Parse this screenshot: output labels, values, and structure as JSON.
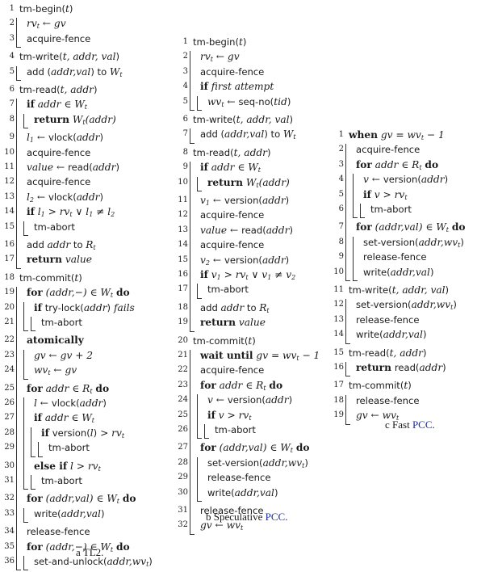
{
  "figures": [
    {
      "id": "a",
      "caption_label": "a",
      "caption_text": "TL2.",
      "caption_link": "",
      "lines": [
        {
          "n": "1",
          "d": 0,
          "html": "<span class='fn'>tm-begin(</span><span class='var'>t</span><span class='fn'>)</span>"
        },
        {
          "n": "2",
          "d": 1,
          "html": "<span class='var'>rv<sub>t</sub> ← gv</span>"
        },
        {
          "n": "3",
          "d": 1,
          "end": true,
          "html": "<span class='fn'>acquire-fence</span>",
          "gap": true
        },
        {
          "n": "4",
          "d": 0,
          "html": "<span class='fn'>tm-write(</span><span class='var'>t, addr, val</span><span class='fn'>)</span>"
        },
        {
          "n": "5",
          "d": 1,
          "end": true,
          "html": "<span class='fn'>add (</span><span class='var'>addr,val</span><span class='fn'>) to </span><span class='var'>W<sub>t</sub></span>",
          "gap": true
        },
        {
          "n": "6",
          "d": 0,
          "html": "<span class='fn'>tm-read(</span><span class='var'>t, addr</span><span class='fn'>)</span>"
        },
        {
          "n": "7",
          "d": 1,
          "html": "<span class='kw'>if</span> <span class='var'>addr ∈ W<sub>t</sub></span>"
        },
        {
          "n": "8",
          "d": 2,
          "end": true,
          "html": "<span class='kw'>return</span> <span class='var'>W<sub>t</sub>(addr)</span>",
          "gap": true
        },
        {
          "n": "9",
          "d": 1,
          "html": "<span class='var'>l<sub>1</sub></span> ← <span class='fn'>vlock(</span><span class='var'>addr</span><span class='fn'>)</span>"
        },
        {
          "n": "10",
          "d": 1,
          "html": "<span class='fn'>acquire-fence</span>"
        },
        {
          "n": "11",
          "d": 1,
          "html": "<span class='var'>value</span> ← <span class='fn'>read(</span><span class='var'>addr</span><span class='fn'>)</span>"
        },
        {
          "n": "12",
          "d": 1,
          "html": "<span class='fn'>acquire-fence</span>"
        },
        {
          "n": "13",
          "d": 1,
          "html": "<span class='var'>l<sub>2</sub></span> ← <span class='fn'>vlock(</span><span class='var'>addr</span><span class='fn'>)</span>"
        },
        {
          "n": "14",
          "d": 1,
          "html": "<span class='kw'>if</span> <span class='var'>l<sub>1</sub> &gt; rv<sub>t</sub> ∨ l<sub>1</sub> ≠ l<sub>2</sub></span>"
        },
        {
          "n": "15",
          "d": 2,
          "end": true,
          "html": "<span class='fn'>tm-abort</span>",
          "gap": true
        },
        {
          "n": "16",
          "d": 1,
          "html": "<span class='fn'>add </span><span class='var'>addr</span><span class='fn'> to </span><span class='var'>R<sub>t</sub></span>"
        },
        {
          "n": "17",
          "d": 1,
          "end": true,
          "html": "<span class='kw'>return</span> <span class='var'>value</span>",
          "gap": true
        },
        {
          "n": "18",
          "d": 0,
          "html": "<span class='fn'>tm-commit(</span><span class='var'>t</span><span class='fn'>)</span>"
        },
        {
          "n": "19",
          "d": 1,
          "html": "<span class='kw'>for</span> <span class='var'>(addr,−) ∈ W<sub>t</sub></span> <span class='kw'>do</span>"
        },
        {
          "n": "20",
          "d": 2,
          "html": "<span class='kw'>if</span> <span class='fn'>try-lock(</span><span class='var'>addr</span><span class='fn'>)</span> <span class='var'>fails</span>"
        },
        {
          "n": "21",
          "d": 3,
          "end": true,
          "html": "<span class='fn'>tm-abort</span>",
          "gap": true
        },
        {
          "n": "22",
          "d": 1,
          "html": "<span class='kw'>atomically</span>"
        },
        {
          "n": "23",
          "d": 2,
          "html": "<span class='var'>gv ← gv + 2</span>"
        },
        {
          "n": "24",
          "d": 2,
          "end": true,
          "html": "<span class='var'>wv<sub>t</sub> ← gv</span>",
          "gap": true
        },
        {
          "n": "25",
          "d": 1,
          "html": "<span class='kw'>for</span> <span class='var'>addr ∈ R<sub>t</sub></span> <span class='kw'>do</span>"
        },
        {
          "n": "26",
          "d": 2,
          "html": "<span class='var'>l</span> ← <span class='fn'>vlock(</span><span class='var'>addr</span><span class='fn'>)</span>"
        },
        {
          "n": "27",
          "d": 2,
          "html": "<span class='kw'>if</span> <span class='var'>addr ∈ W<sub>t</sub></span>"
        },
        {
          "n": "28",
          "d": 3,
          "html": "<span class='kw'>if</span> <span class='fn'>version(</span><span class='var'>l</span><span class='fn'>)</span> <span class='var'>&gt; rv<sub>t</sub></span>"
        },
        {
          "n": "29",
          "d": 4,
          "end": true,
          "html": "<span class='fn'>tm-abort</span>",
          "gap": true
        },
        {
          "n": "30",
          "d": 2,
          "html": "<span class='kw'>else if</span> <span class='var'>l &gt; rv<sub>t</sub></span>"
        },
        {
          "n": "31",
          "d": 3,
          "end": true,
          "html": "<span class='fn'>tm-abort</span>",
          "gap": true
        },
        {
          "n": "32",
          "d": 1,
          "html": "<span class='kw'>for</span> <span class='var'>(addr,val) ∈ W<sub>t</sub></span> <span class='kw'>do</span>"
        },
        {
          "n": "33",
          "d": 2,
          "end": true,
          "html": "<span class='fn'>write(</span><span class='var'>addr,val</span><span class='fn'>)</span>",
          "gap": true
        },
        {
          "n": "34",
          "d": 1,
          "html": "<span class='fn'>release-fence</span>"
        },
        {
          "n": "35",
          "d": 1,
          "html": "<span class='kw'>for</span> <span class='var'>(addr,−) ∈ W<sub>t</sub></span> <span class='kw'>do</span>"
        },
        {
          "n": "36",
          "d": 2,
          "end": true,
          "html": "<span class='fn'>set-and-unlock(</span><span class='var'>addr,wv<sub>t</sub></span><span class='fn'>)</span>"
        }
      ]
    },
    {
      "id": "b",
      "caption_label": "b",
      "caption_text": "Speculative ",
      "caption_link": "PCC",
      "lines": [
        {
          "n": "1",
          "d": 0,
          "html": "<span class='fn'>tm-begin(</span><span class='var'>t</span><span class='fn'>)</span>"
        },
        {
          "n": "2",
          "d": 1,
          "html": "<span class='var'>rv<sub>t</sub> ← gv</span>"
        },
        {
          "n": "3",
          "d": 1,
          "html": "<span class='fn'>acquire-fence</span>"
        },
        {
          "n": "4",
          "d": 1,
          "html": "<span class='kw'>if</span> <span class='var'>first attempt</span>"
        },
        {
          "n": "5",
          "d": 2,
          "end": true,
          "html": "<span class='var'>wv<sub>t</sub></span> ← <span class='fn'>seq-no(</span><span class='var'>tid</span><span class='fn'>)</span>",
          "gap": true
        },
        {
          "n": "6",
          "d": 0,
          "html": "<span class='fn'>tm-write(</span><span class='var'>t, addr, val</span><span class='fn'>)</span>"
        },
        {
          "n": "7",
          "d": 1,
          "end": true,
          "html": "<span class='fn'>add (</span><span class='var'>addr,val</span><span class='fn'>) to </span><span class='var'>W<sub>t</sub></span>",
          "gap": true
        },
        {
          "n": "8",
          "d": 0,
          "html": "<span class='fn'>tm-read(</span><span class='var'>t, addr</span><span class='fn'>)</span>"
        },
        {
          "n": "9",
          "d": 1,
          "html": "<span class='kw'>if</span> <span class='var'>addr ∈ W<sub>t</sub></span>"
        },
        {
          "n": "10",
          "d": 2,
          "end": true,
          "html": "<span class='kw'>return</span> <span class='var'>W<sub>t</sub>(addr)</span>",
          "gap": true
        },
        {
          "n": "11",
          "d": 1,
          "html": "<span class='var'>v<sub>1</sub></span> ← <span class='fn'>version(</span><span class='var'>addr</span><span class='fn'>)</span>"
        },
        {
          "n": "12",
          "d": 1,
          "html": "<span class='fn'>acquire-fence</span>"
        },
        {
          "n": "13",
          "d": 1,
          "html": "<span class='var'>value</span> ← <span class='fn'>read(</span><span class='var'>addr</span><span class='fn'>)</span>"
        },
        {
          "n": "14",
          "d": 1,
          "html": "<span class='fn'>acquire-fence</span>"
        },
        {
          "n": "15",
          "d": 1,
          "html": "<span class='var'>v<sub>2</sub></span> ← <span class='fn'>version(</span><span class='var'>addr</span><span class='fn'>)</span>"
        },
        {
          "n": "16",
          "d": 1,
          "html": "<span class='kw'>if</span> <span class='var'>v<sub>1</sub> &gt; rv<sub>t</sub> ∨ v<sub>1</sub> ≠ v<sub>2</sub></span>"
        },
        {
          "n": "17",
          "d": 2,
          "end": true,
          "html": "<span class='fn'>tm-abort</span>",
          "gap": true
        },
        {
          "n": "18",
          "d": 1,
          "html": "<span class='fn'>add </span><span class='var'>addr</span><span class='fn'> to </span><span class='var'>R<sub>t</sub></span>"
        },
        {
          "n": "19",
          "d": 1,
          "end": true,
          "html": "<span class='kw'>return</span> <span class='var'>value</span>",
          "gap": true
        },
        {
          "n": "20",
          "d": 0,
          "html": "<span class='fn'>tm-commit(</span><span class='var'>t</span><span class='fn'>)</span>"
        },
        {
          "n": "21",
          "d": 1,
          "html": "<span class='kw'>wait until</span> <span class='var'>gv = wv<sub>t</sub> − 1</span>"
        },
        {
          "n": "22",
          "d": 1,
          "html": "<span class='fn'>acquire-fence</span>"
        },
        {
          "n": "23",
          "d": 1,
          "html": "<span class='kw'>for</span> <span class='var'>addr ∈ R<sub>t</sub></span> <span class='kw'>do</span>"
        },
        {
          "n": "24",
          "d": 2,
          "html": "<span class='var'>v</span> ← <span class='fn'>version(</span><span class='var'>addr</span><span class='fn'>)</span>"
        },
        {
          "n": "25",
          "d": 2,
          "html": "<span class='kw'>if</span> <span class='var'>v &gt; rv<sub>t</sub></span>"
        },
        {
          "n": "26",
          "d": 3,
          "end": true,
          "html": "<span class='fn'>tm-abort</span>",
          "gap": true
        },
        {
          "n": "27",
          "d": 1,
          "html": "<span class='kw'>for</span> <span class='var'>(addr,val) ∈ W<sub>t</sub></span> <span class='kw'>do</span>"
        },
        {
          "n": "28",
          "d": 2,
          "html": "<span class='fn'>set-version(</span><span class='var'>addr,wv<sub>t</sub></span><span class='fn'>)</span>"
        },
        {
          "n": "29",
          "d": 2,
          "html": "<span class='fn'>release-fence</span>"
        },
        {
          "n": "30",
          "d": 2,
          "end": true,
          "html": "<span class='fn'>write(</span><span class='var'>addr,val</span><span class='fn'>)</span>",
          "gap": true
        },
        {
          "n": "31",
          "d": 1,
          "html": "<span class='fn'>release-fence</span>"
        },
        {
          "n": "32",
          "d": 1,
          "end": true,
          "html": "<span class='var'>gv ← wv<sub>t</sub></span>"
        }
      ]
    },
    {
      "id": "c",
      "caption_label": "c",
      "caption_text": "Fast ",
      "caption_link": "PCC",
      "lines": [
        {
          "n": "1",
          "d": 0,
          "html": "<span class='kw'>when</span> <span class='var'>gv = wv<sub>t</sub> − 1</span>"
        },
        {
          "n": "2",
          "d": 1,
          "html": "<span class='fn'>acquire-fence</span>"
        },
        {
          "n": "3",
          "d": 1,
          "html": "<span class='kw'>for</span> <span class='var'>addr ∈ R<sub>t</sub></span> <span class='kw'>do</span>"
        },
        {
          "n": "4",
          "d": 2,
          "html": "<span class='var'>v</span> ← <span class='fn'>version(</span><span class='var'>addr</span><span class='fn'>)</span>"
        },
        {
          "n": "5",
          "d": 2,
          "html": "<span class='kw'>if</span> <span class='var'>v &gt; rv<sub>t</sub></span>"
        },
        {
          "n": "6",
          "d": 3,
          "end": true,
          "html": "<span class='fn'>tm-abort</span>",
          "gap": true
        },
        {
          "n": "7",
          "d": 1,
          "html": "<span class='kw'>for</span> <span class='var'>(addr,val) ∈ W<sub>t</sub></span> <span class='kw'>do</span>"
        },
        {
          "n": "8",
          "d": 2,
          "html": "<span class='fn'>set-version(</span><span class='var'>addr,wv<sub>t</sub></span><span class='fn'>)</span>"
        },
        {
          "n": "9",
          "d": 2,
          "html": "<span class='fn'>release-fence</span>"
        },
        {
          "n": "10",
          "d": 2,
          "end": true,
          "html": "<span class='fn'>write(</span><span class='var'>addr,val</span><span class='fn'>)</span>",
          "gap": true
        },
        {
          "n": "11",
          "d": 0,
          "html": "<span class='fn'>tm-write(</span><span class='var'>t, addr, val</span><span class='fn'>)</span>"
        },
        {
          "n": "12",
          "d": 1,
          "html": "<span class='fn'>set-version(</span><span class='var'>addr,wv<sub>t</sub></span><span class='fn'>)</span>"
        },
        {
          "n": "13",
          "d": 1,
          "html": "<span class='fn'>release-fence</span>"
        },
        {
          "n": "14",
          "d": 1,
          "end": true,
          "html": "<span class='fn'>write(</span><span class='var'>addr,val</span><span class='fn'>)</span>",
          "gap": true
        },
        {
          "n": "15",
          "d": 0,
          "html": "<span class='fn'>tm-read(</span><span class='var'>t, addr</span><span class='fn'>)</span>"
        },
        {
          "n": "16",
          "d": 1,
          "end": true,
          "html": "<span class='kw'>return</span> <span class='fn'>read(</span><span class='var'>addr</span><span class='fn'>)</span>",
          "gap": true
        },
        {
          "n": "17",
          "d": 0,
          "html": "<span class='fn'>tm-commit(</span><span class='var'>t</span><span class='fn'>)</span>"
        },
        {
          "n": "18",
          "d": 1,
          "html": "<span class='fn'>release-fence</span>"
        },
        {
          "n": "19",
          "d": 1,
          "end": true,
          "html": "<span class='var'>gv ← wv<sub>t</sub></span>"
        }
      ]
    }
  ]
}
